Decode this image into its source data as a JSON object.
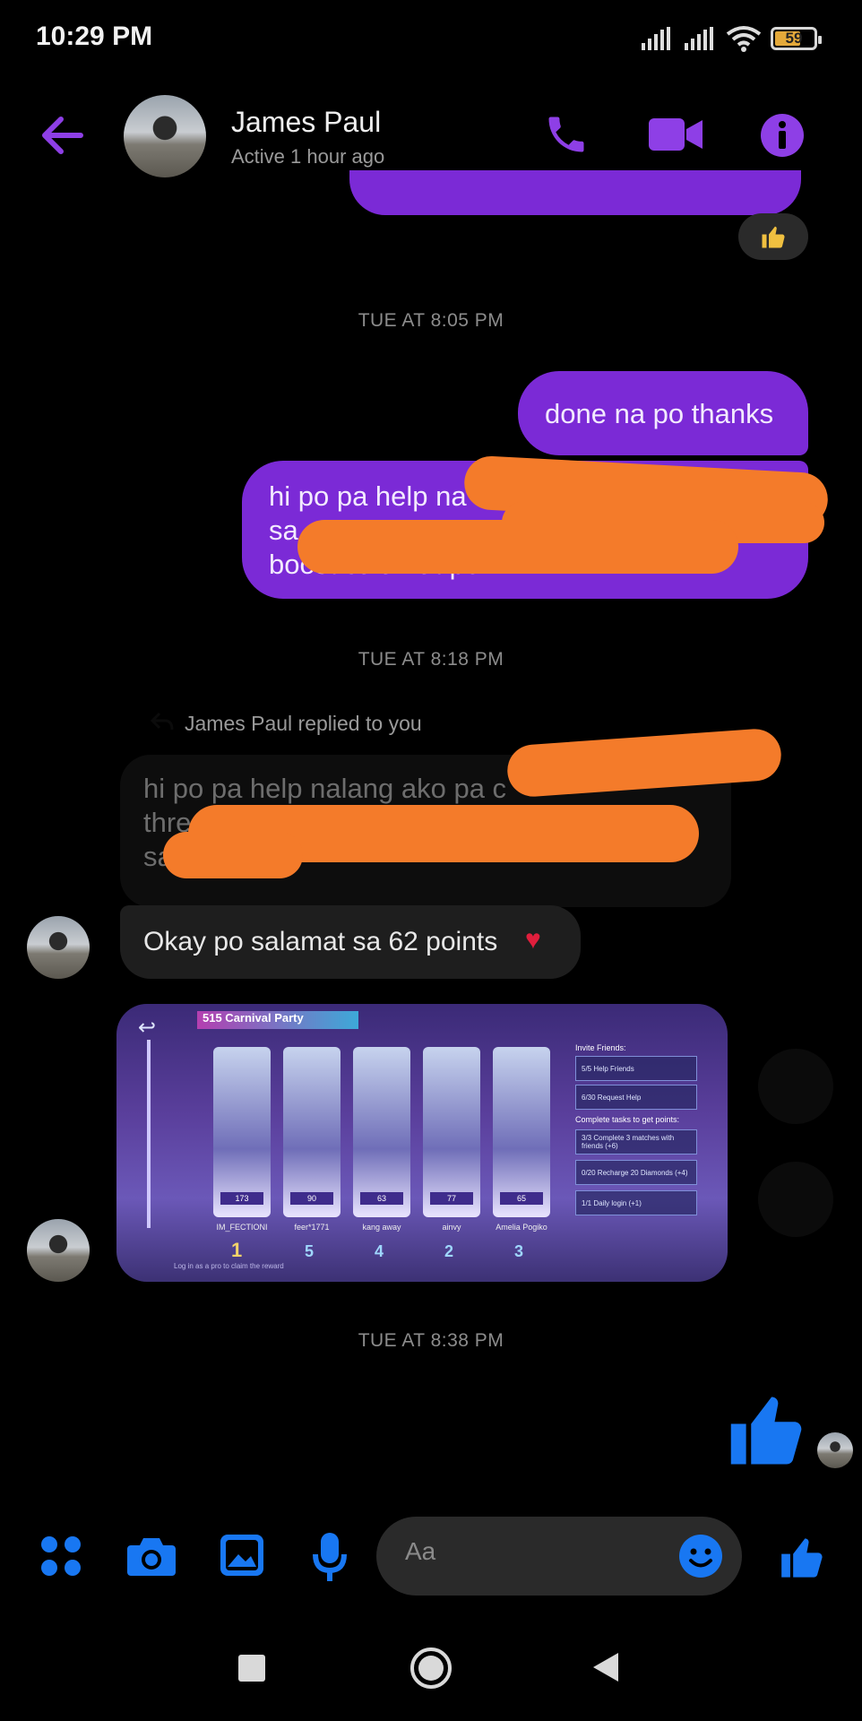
{
  "status_bar": {
    "time": "10:29 PM",
    "battery": "59"
  },
  "header": {
    "name": "James Paul",
    "status": "Active 1 hour ago"
  },
  "messages": {
    "ts1": "TUE AT 8:05 PM",
    "out1": "done na po thanks",
    "out2_lines": [
      "hi po pa help na",
      "sa",
      "boost salamat po"
    ],
    "ts2": "TUE AT 8:18 PM",
    "reply_label": "James Paul replied to you",
    "quoted_lines": [
      "hi po pa help nalang ako pa c",
      "thre",
      "sa"
    ],
    "in1": "Okay po salamat sa 62 points",
    "ts3": "TUE AT 8:38 PM"
  },
  "game_image": {
    "title": "515 Carnival Party",
    "panel": {
      "invite": "Invite Friends:",
      "tasks": "Complete tasks to get points:",
      "rows": [
        "5/5  Help Friends",
        "6/30  Request Help",
        "3/3  Complete 3 matches with friends (+6)",
        "0/20  Recharge 20 Diamonds (+4)",
        "1/1  Daily login (+1)"
      ]
    },
    "cards": [
      {
        "name": "IM_FECTIONI",
        "points": "173"
      },
      {
        "name": "feer*1771",
        "points": "90"
      },
      {
        "name": "kang away",
        "points": "63"
      },
      {
        "name": "ainvy",
        "points": "77"
      },
      {
        "name": "Amelia Pogiko",
        "points": "65"
      }
    ],
    "ranks": [
      "1",
      "5",
      "4",
      "2",
      "3"
    ],
    "footer": "Log in as a pro to claim the reward"
  },
  "composer": {
    "placeholder": "Aa"
  },
  "colors": {
    "accent": "#7b2ad6",
    "blue": "#1877f2",
    "redact": "#f47b2a"
  }
}
